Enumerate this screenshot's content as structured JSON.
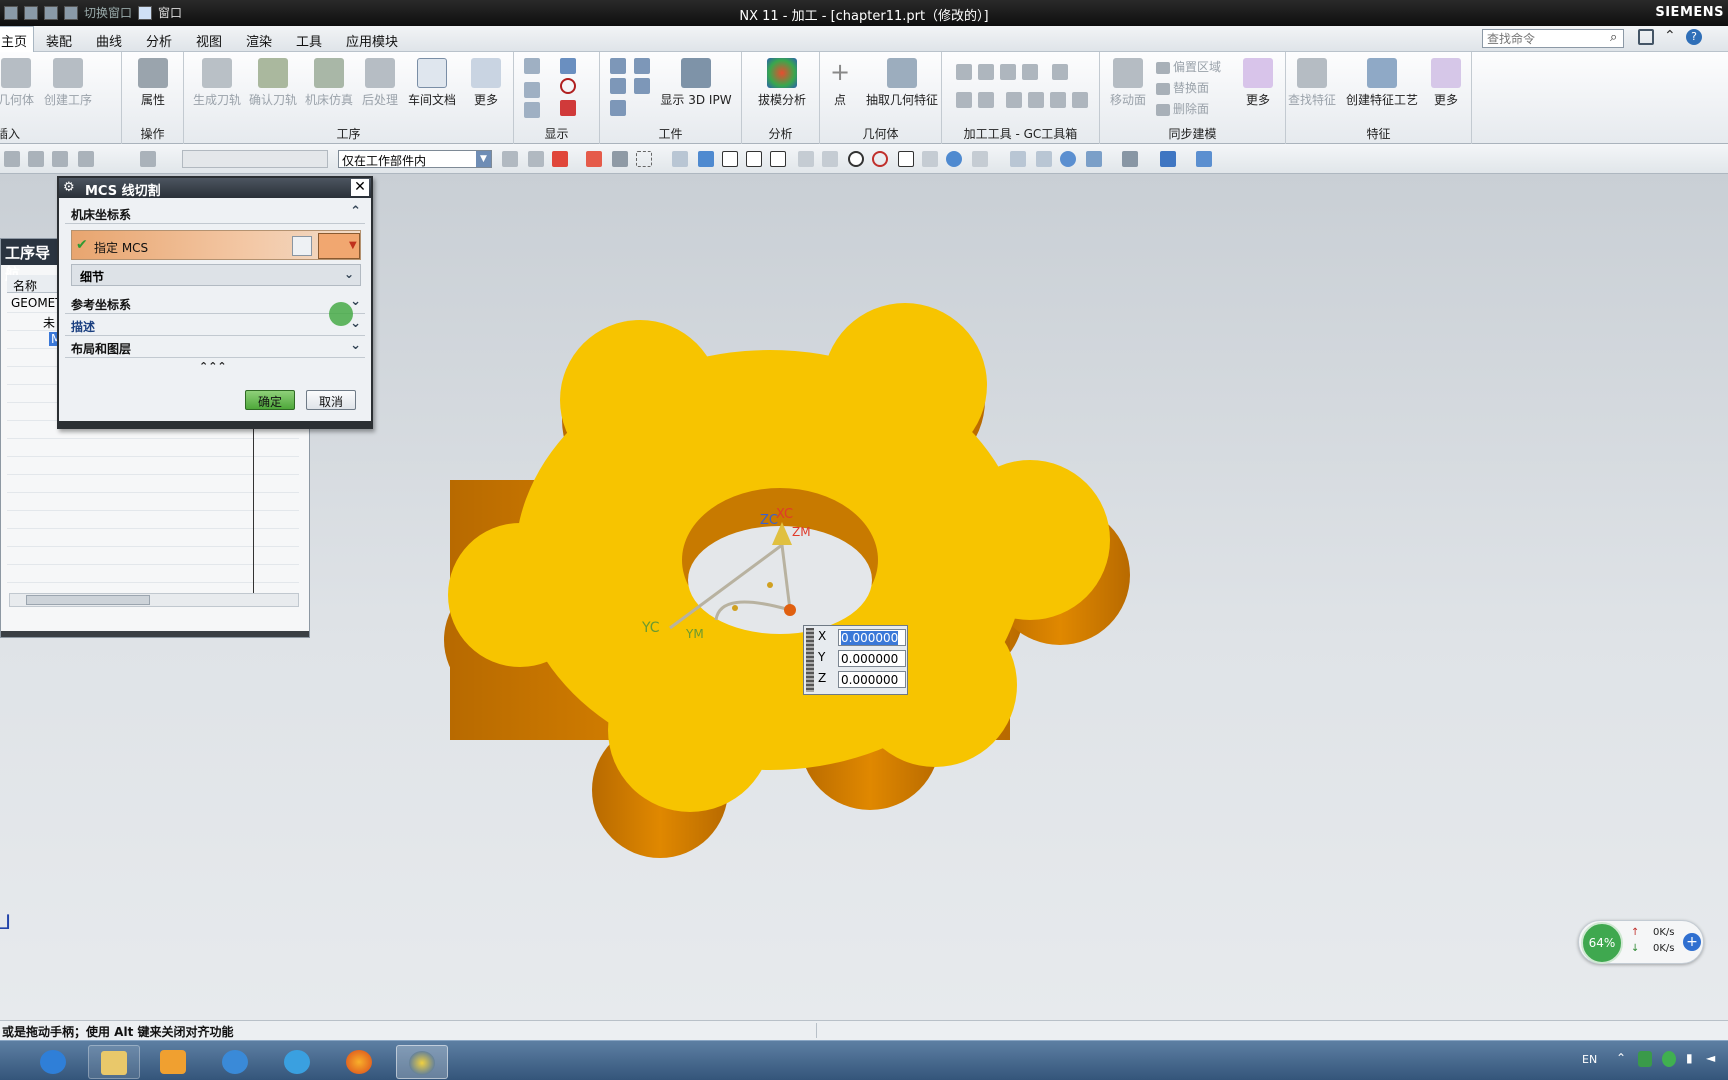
{
  "titlebar": {
    "title": "NX 11 - 加工 - [chapter11.prt（修改的）]",
    "brand": "SIEMENS",
    "quick_switch": "切换窗口",
    "window": "窗口"
  },
  "menu": {
    "tabs": [
      "主页",
      "装配",
      "曲线",
      "分析",
      "视图",
      "渲染",
      "工具",
      "应用模块"
    ],
    "search_placeholder": "查找命令"
  },
  "ribbon": {
    "btn_geometry": "几何体",
    "btn_create_op": "创建工序",
    "btn_properties": "属性",
    "btn_gen_path": "生成刀轨",
    "btn_verify_path": "确认刀轨",
    "btn_sim": "机床仿真",
    "btn_post": "后处理",
    "btn_shopdoc": "车间文档",
    "btn_more": "更多",
    "btn_show3d": "显示 3D IPW",
    "btn_draft": "拔模分析",
    "btn_point": "点",
    "btn_extract": "抽取几何特征",
    "btn_move_face": "移动面",
    "sync_offset": "偏置区域",
    "sync_replace": "替换面",
    "sync_delete": "删除面",
    "btn_find_feat": "查找特征",
    "btn_feat_proc": "创建特征工艺",
    "grp_insert": "插入",
    "grp_ops": "操作",
    "grp_proc": "工序",
    "grp_display": "显示",
    "grp_workpiece": "工件",
    "grp_analysis": "分析",
    "grp_geom": "几何体",
    "grp_gc": "加工工具 - GC工具箱",
    "grp_sync": "同步建模",
    "grp_feature": "特征",
    "filter": "仅在工作部件内"
  },
  "nav": {
    "title": "工序导航",
    "col_name": "名称",
    "rows": [
      "GEOMETRY",
      "未",
      "MCS"
    ]
  },
  "dialog": {
    "title": "MCS 线切割",
    "sec_machine_cs": "机床坐标系",
    "specify_mcs": "指定 MCS",
    "details": "细节",
    "sec_ref_cs": "参考坐标系",
    "sec_desc": "描述",
    "sec_layout": "布局和图层",
    "ok": "确定",
    "cancel": "取消"
  },
  "viewport": {
    "axis_labels": [
      "ZC",
      "XC",
      "ZM",
      "YC",
      "YM"
    ]
  },
  "coords": {
    "x_label": "X",
    "x": "0.000000",
    "y_label": "Y",
    "y": "0.000000",
    "z_label": "Z",
    "z": "0.000000"
  },
  "status": {
    "message": "或是拖动手柄；使用 Alt 键来关闭对齐功能"
  },
  "netwidget": {
    "cpu": "64%",
    "up": "0K/s",
    "down": "0K/s"
  },
  "tray": {
    "lang": "EN"
  },
  "colors": {
    "part_top": "#f7c400",
    "part_side": "#d98000",
    "accent_green": "#3fa84f"
  }
}
